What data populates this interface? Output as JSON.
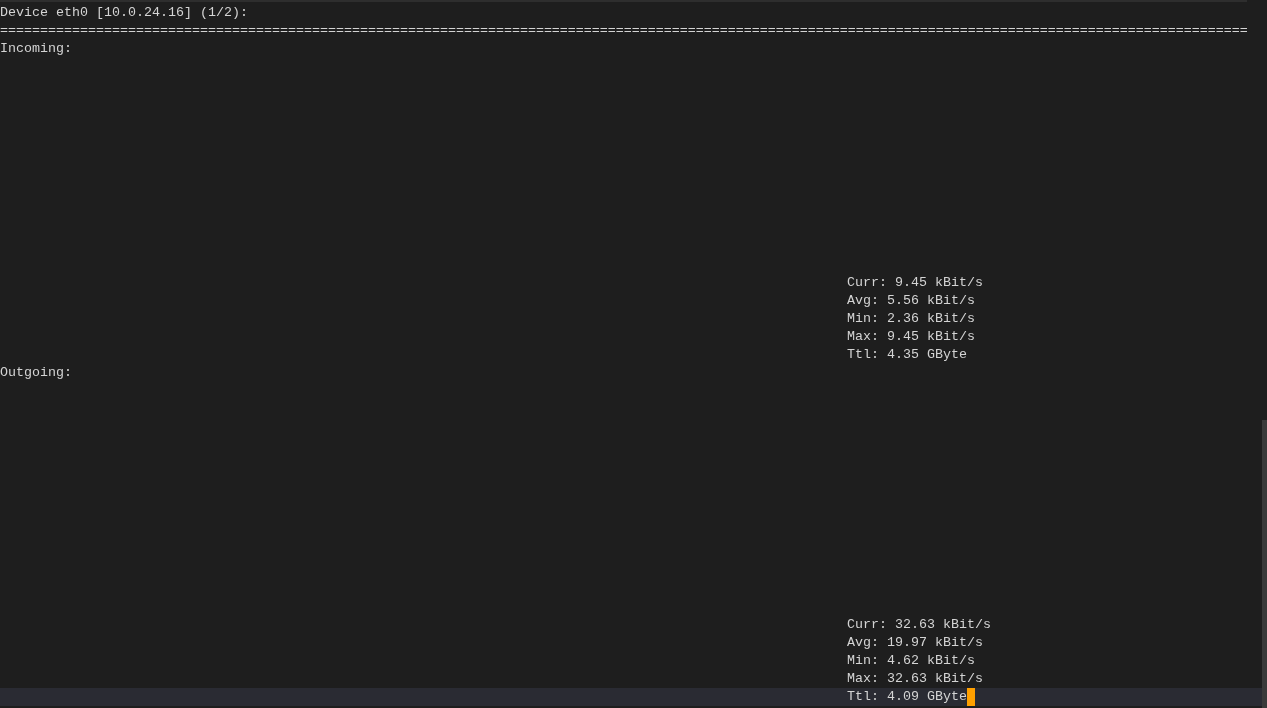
{
  "header": "Device eth0 [10.0.24.16] (1/2):",
  "separator": "============================================================================================================================================================",
  "sections": [
    {
      "label": "Incoming:",
      "stats": [
        "Curr: 9.45 kBit/s",
        "Avg: 5.56 kBit/s",
        "Min: 2.36 kBit/s",
        "Max: 9.45 kBit/s",
        "Ttl: 4.35 GByte"
      ]
    },
    {
      "label": "Outgoing:",
      "stats": [
        "Curr: 32.63 kBit/s",
        "Avg: 19.97 kBit/s",
        "Min: 4.62 kBit/s",
        "Max: 32.63 kBit/s",
        "Ttl: 4.09 GByte"
      ]
    }
  ]
}
